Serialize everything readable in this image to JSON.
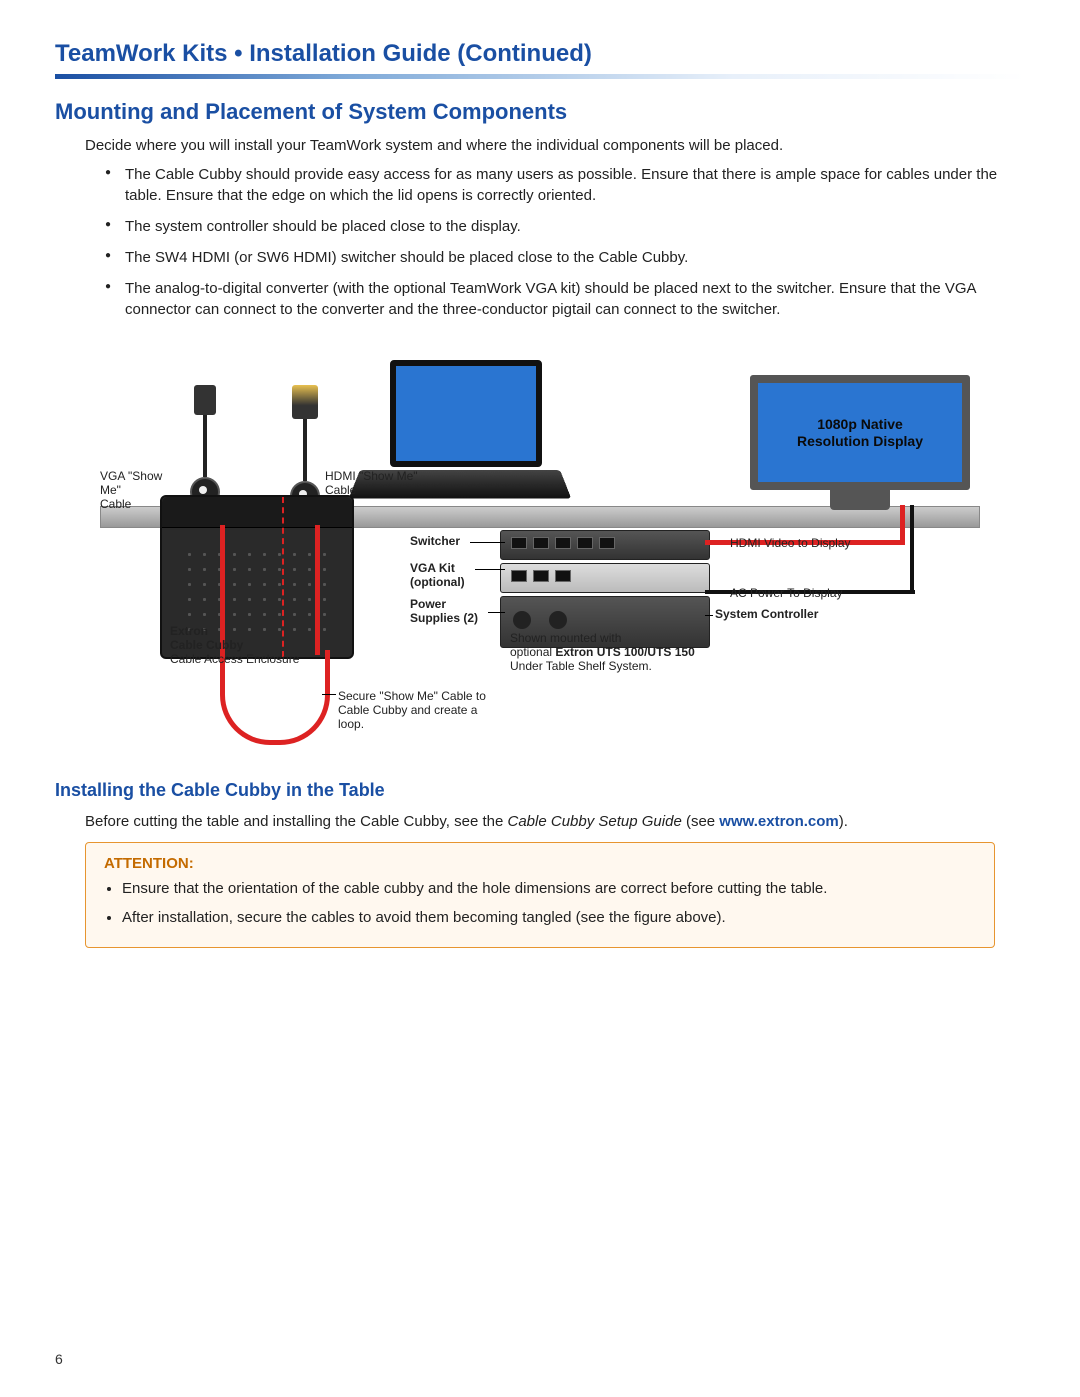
{
  "doc_title": "TeamWork Kits • Installation Guide (Continued)",
  "section_heading": "Mounting and Placement of System Components",
  "intro_text": "Decide where you will install your TeamWork system and where the individual components will be placed.",
  "bullets": [
    "The Cable Cubby should provide easy access for as many users as possible. Ensure that there is ample space for cables under the table. Ensure that the edge on which the lid opens is correctly oriented.",
    "The system controller should be placed close to the display.",
    "The SW4 HDMI (or SW6 HDMI) switcher should be placed close to the Cable Cubby.",
    "The analog-to-digital converter (with the optional TeamWork VGA kit) should be placed next to the switcher. Ensure that the VGA connector can connect to the converter and the three-conductor pigtail can connect to the switcher."
  ],
  "diagram": {
    "display_line1": "1080p Native",
    "display_line2": "Resolution Display",
    "vga_cable_label": "VGA \"Show Me\"\nCable",
    "hdmi_cable_label": "HDMI \"Show Me\"\nCable",
    "switcher_label": "Switcher",
    "vga_kit_label": "VGA Kit\n(optional)",
    "power_label": "Power\nSupplies (2)",
    "cubby_label_bold": "Extron\nCable Cubby",
    "cubby_label_sub": "Cable Access Enclosure",
    "system_controller_label": "System Controller",
    "hdmi_out_label": "HDMI Video to Display",
    "ac_power_label": "AC Power To Display",
    "shelf_note_line1": "Shown mounted with",
    "shelf_note_line2": "optional Extron UTS 100/UTS 150",
    "shelf_note_line3": "Under Table Shelf System.",
    "secure_note": "Secure \"Show Me\" Cable to Cable Cubby and create a loop."
  },
  "subheading": "Installing the Cable Cubby in the Table",
  "sub_text_prefix": "Before cutting the table and installing the Cable Cubby, see the ",
  "sub_text_italic": "Cable Cubby Setup Guide",
  "sub_text_mid": " (see ",
  "sub_link_text": "www.extron.com",
  "sub_text_suffix": ").",
  "attention_title": "ATTENTION:",
  "attention_items": [
    "Ensure that the orientation of the cable cubby and the hole dimensions are correct before cutting the table.",
    "After installation, secure the cables to avoid them becoming tangled (see the figure above)."
  ],
  "page_number": "6"
}
